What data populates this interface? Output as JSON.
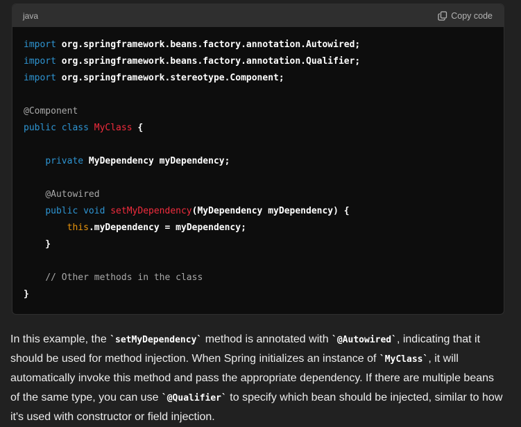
{
  "code_block": {
    "language": "java",
    "copy_label": "Copy code",
    "copy_icon": "copy-icon",
    "lines": {
      "l1": {
        "kw": "import",
        "rest": " org.springframework.beans.factory.annotation.Autowired;"
      },
      "l2": {
        "kw": "import",
        "rest": " org.springframework.beans.factory.annotation.Qualifier;"
      },
      "l3": {
        "kw": "import",
        "rest": " org.springframework.stereotype.Component;"
      },
      "l5": {
        "ann": "@Component"
      },
      "l6": {
        "kw": "public class",
        "cls": "MyClass",
        "rest": " {"
      },
      "l8": {
        "indent": "    ",
        "kw": "private",
        "rest": " MyDependency myDependency;"
      },
      "l10": {
        "indent": "    ",
        "ann": "@Autowired"
      },
      "l11": {
        "indent": "    ",
        "kw": "public void",
        "fn": "setMyDependency",
        "rest": "(MyDependency myDependency) {"
      },
      "l12": {
        "indent": "        ",
        "ths": "this",
        "rest": ".myDependency = myDependency;"
      },
      "l13": {
        "rest": "    }"
      },
      "l15": {
        "indent": "    ",
        "cmt": "// Other methods in the class"
      },
      "l16": {
        "rest": "}"
      }
    }
  },
  "explanation": {
    "p1": "In this example, the ",
    "c1": "`setMyDependency`",
    "p2": " method is annotated with ",
    "c2": "`@Autowired`",
    "p3": ", indicating that it",
    "p4": "should be used for method injection. When Spring initializes an instance of ",
    "c3": "`MyClass`",
    "p5": ", it will",
    "p6": "automatically invoke this method and pass the appropriate dependency. If there are multiple beans",
    "p7": "of the same type, you can use ",
    "c4": "`@Qualifier`",
    "p8": " to specify which bean should be injected, similar to how",
    "p9": "it's used with constructor or field injection."
  }
}
